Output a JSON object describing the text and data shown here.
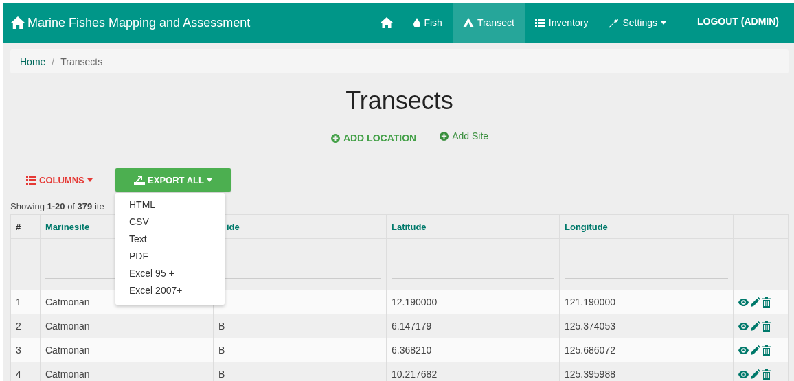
{
  "navbar": {
    "brand": "Marine Fishes Mapping and Assessment",
    "items": [
      {
        "kind": "home",
        "selected": false
      },
      {
        "kind": "link",
        "label": "Fish",
        "selected": false
      },
      {
        "kind": "link",
        "label": "Transect",
        "selected": true
      },
      {
        "kind": "link",
        "label": "Inventory",
        "selected": false
      },
      {
        "kind": "dropdown",
        "label": "Settings",
        "selected": false
      },
      {
        "kind": "logout",
        "label": "LOGOUT (ADMIN)",
        "selected": false
      }
    ]
  },
  "breadcrumb": [
    {
      "label": "Home",
      "current": false
    },
    {
      "separator": "/",
      "label": "Transects",
      "current": true
    }
  ],
  "title": "Transects",
  "actions": [
    {
      "kind": "strong",
      "label": "ADD LOCATION"
    },
    {
      "kind": "plain",
      "label": "Add Site"
    }
  ],
  "toolbar": {
    "columns_button": "COLUMNS",
    "export_button": {
      "label": "EXPORT ALL",
      "expanded": true
    },
    "export_menu": [
      "HTML",
      "CSV",
      "Text",
      "PDF",
      "Excel 95 +",
      "Excel 2007+"
    ]
  },
  "summary": "Showing **1-20** of **379** ite",
  "table": {
    "columns": [
      "#",
      "Marinesite",
      "ide",
      "Latitude",
      "Longitude"
    ],
    "rows": [
      {
        "cells": [
          "1",
          "Catmonan",
          null,
          "12.190000",
          "121.190000"
        ]
      },
      {
        "cells": [
          "2",
          "Catmonan",
          "B",
          "6.147179",
          "125.374053"
        ]
      },
      {
        "cells": [
          "3",
          "Catmonan",
          "B",
          "6.368210",
          "125.686072"
        ]
      },
      {
        "cells": [
          "4",
          "Catmonan",
          "B",
          "10.217682",
          "125.395988"
        ]
      }
    ]
  }
}
